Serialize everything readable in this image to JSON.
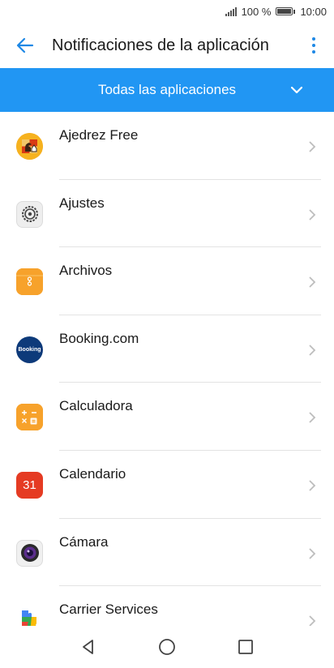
{
  "status": {
    "battery_percent": "100 %",
    "time": "10:00"
  },
  "header": {
    "title": "Notificaciones de la aplicación"
  },
  "filter": {
    "label": "Todas las aplicaciones"
  },
  "apps": [
    {
      "label": "Ajedrez Free",
      "icon": "chess-icon"
    },
    {
      "label": "Ajustes",
      "icon": "settings-icon"
    },
    {
      "label": "Archivos",
      "icon": "files-icon"
    },
    {
      "label": "Booking.com",
      "icon": "booking-icon",
      "icon_text": "Booking"
    },
    {
      "label": "Calculadora",
      "icon": "calculator-icon"
    },
    {
      "label": "Calendario",
      "icon": "calendar-icon",
      "icon_text": "31"
    },
    {
      "label": "Cámara",
      "icon": "camera-icon"
    },
    {
      "label": "Carrier Services",
      "icon": "carrier-services-icon"
    }
  ],
  "colors": {
    "accent": "#2196f3",
    "icon_blue": "#1e88e5"
  }
}
